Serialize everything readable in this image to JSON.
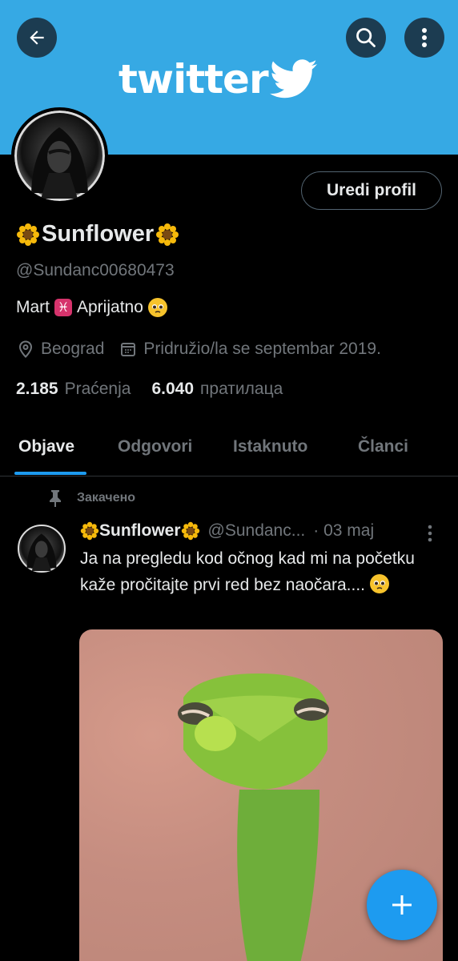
{
  "header": {
    "logo_text": "twitter",
    "brand_color": "#36a9e4",
    "back_icon": "arrow-left-icon",
    "search_icon": "search-icon",
    "more_icon": "more-vertical-icon"
  },
  "profile": {
    "edit_button": "Uredi profil",
    "display_name": "Sunflower",
    "handle": "@Sundanc00680473",
    "bio_before": "Mart",
    "bio_after": "Aprijatno",
    "location": "Beograd",
    "joined": "Pridružio/la se septembar 2019.",
    "following_count": "2.185",
    "following_label": "Praćenja",
    "followers_count": "6.040",
    "followers_label": "пратилаца"
  },
  "tabs": [
    {
      "label": "Objave",
      "active": true
    },
    {
      "label": "Odgovori",
      "active": false
    },
    {
      "label": "Istaknuto",
      "active": false
    },
    {
      "label": "Članci",
      "active": false
    }
  ],
  "tweet": {
    "pinned_label": "Закачено",
    "name": "Sunflower",
    "handle": "@Sundanc...",
    "date": "· 03 maj",
    "text": "Ja na pregledu kod očnog kad mi na početku kaže pročitajte prvi red bez naočara...."
  },
  "fab": {
    "icon": "plus-icon",
    "color": "#1d9bf0"
  }
}
